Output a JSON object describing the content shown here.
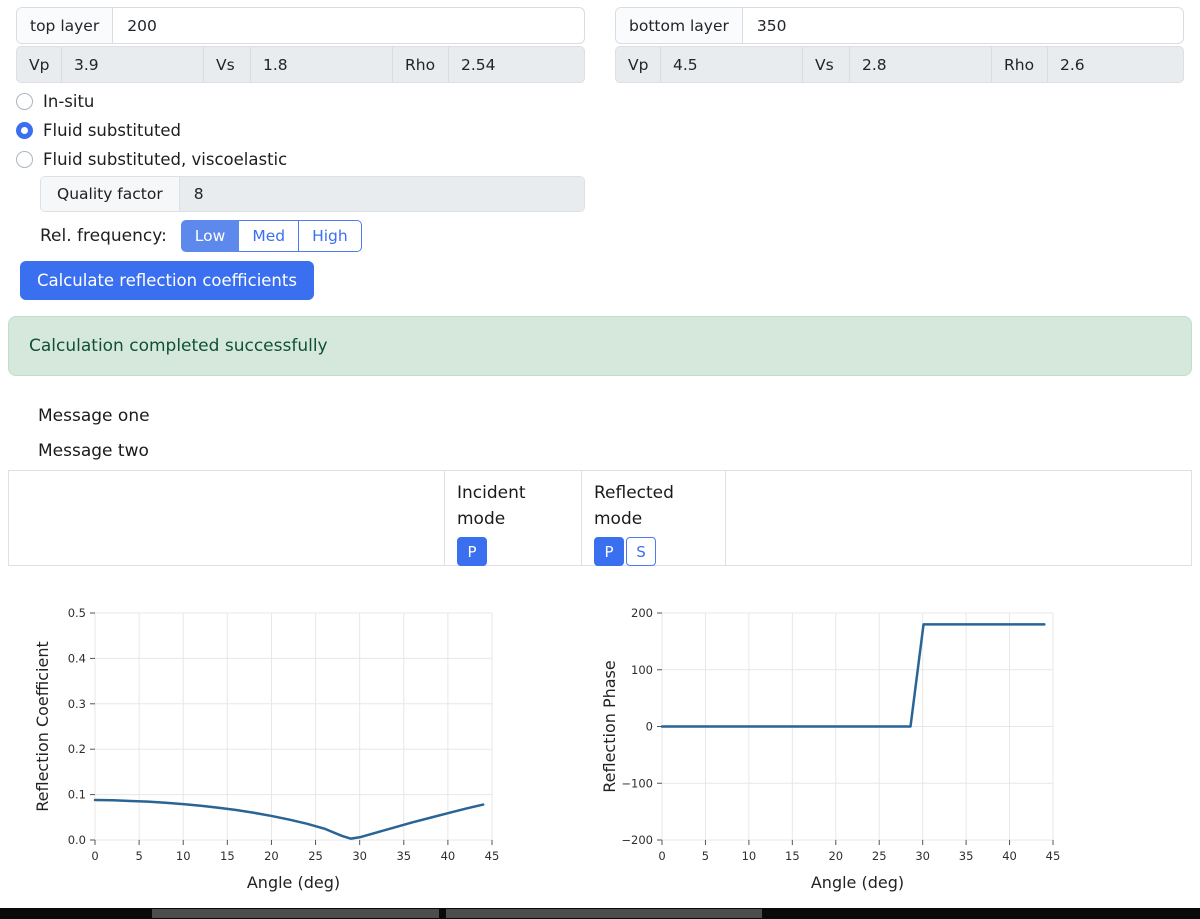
{
  "layers": {
    "top": {
      "label": "top layer",
      "value": "200",
      "vp_label": "Vp",
      "vp": "3.9",
      "vs_label": "Vs",
      "vs": "1.8",
      "rho_label": "Rho",
      "rho": "2.54"
    },
    "bottom": {
      "label": "bottom layer",
      "value": "350",
      "vp_label": "Vp",
      "vp": "4.5",
      "vs_label": "Vs",
      "vs": "2.8",
      "rho_label": "Rho",
      "rho": "2.6"
    }
  },
  "options": {
    "items": [
      {
        "label": "In-situ",
        "selected": false
      },
      {
        "label": "Fluid substituted",
        "selected": true
      },
      {
        "label": "Fluid substituted, viscoelastic",
        "selected": false
      }
    ]
  },
  "quality_factor": {
    "label": "Quality factor",
    "value": "8"
  },
  "rel_frequency": {
    "label": "Rel. frequency:",
    "options": [
      "Low",
      "Med",
      "High"
    ],
    "selected": "Low"
  },
  "calculate_button": "Calculate reflection coefficients",
  "alert": {
    "text": "Calculation completed successfully"
  },
  "messages": [
    "Message one",
    "Message two"
  ],
  "mode_table": {
    "incident": {
      "header": "Incident mode",
      "buttons": [
        {
          "label": "P",
          "active": true
        }
      ]
    },
    "reflected": {
      "header": "Reflected mode",
      "buttons": [
        {
          "label": "P",
          "active": true
        },
        {
          "label": "S",
          "active": false
        }
      ]
    }
  },
  "colors": {
    "primary": "#3a6ff0",
    "primary_light": "#5d89ec",
    "primary_border": "#4d7cf0",
    "success_bg": "#d6e8dc",
    "success_border": "#c3dccc",
    "success_text": "#0f5132",
    "line": "#2a6496"
  },
  "chart_data": [
    {
      "type": "line",
      "title": "",
      "xlabel": "Angle (deg)",
      "ylabel": "Reflection Coefficient",
      "xlim": [
        0,
        45
      ],
      "ylim": [
        0,
        0.5
      ],
      "xticks": [
        0,
        5,
        10,
        15,
        20,
        25,
        30,
        35,
        40,
        45
      ],
      "xtick_labels": [
        "0",
        "5",
        "10",
        "15",
        "20",
        "25",
        "30",
        "35",
        "40",
        "45"
      ],
      "yticks": [
        0,
        0.1,
        0.2,
        0.3,
        0.4,
        0.5
      ],
      "ytick_labels": [
        "0.0",
        "0.1",
        "0.2",
        "0.3",
        "0.4",
        "0.5"
      ],
      "grid": true,
      "legend": false,
      "line_color": "#2a6496",
      "x": [
        0,
        2,
        4,
        6,
        8,
        10,
        12,
        14,
        16,
        18,
        20,
        22,
        24,
        26,
        28,
        29,
        30,
        32,
        34,
        36,
        38,
        40,
        42,
        44
      ],
      "y": [
        0.088,
        0.0875,
        0.086,
        0.0845,
        0.082,
        0.079,
        0.0755,
        0.071,
        0.066,
        0.06,
        0.053,
        0.045,
        0.036,
        0.025,
        0.009,
        0.003,
        0.006,
        0.017,
        0.028,
        0.039,
        0.049,
        0.059,
        0.069,
        0.078
      ]
    },
    {
      "type": "line",
      "title": "",
      "xlabel": "Angle (deg)",
      "ylabel": "Reflection Phase",
      "xlim": [
        0,
        45
      ],
      "ylim": [
        -200,
        200
      ],
      "xticks": [
        0,
        5,
        10,
        15,
        20,
        25,
        30,
        35,
        40,
        45
      ],
      "xtick_labels": [
        "0",
        "5",
        "10",
        "15",
        "20",
        "25",
        "30",
        "35",
        "40",
        "45"
      ],
      "yticks": [
        -200,
        -100,
        0,
        100,
        200
      ],
      "ytick_labels": [
        "−200",
        "−100",
        "0",
        "100",
        "200"
      ],
      "grid": true,
      "legend": false,
      "line_color": "#2a6496",
      "x": [
        0,
        5,
        10,
        15,
        20,
        25,
        28.6,
        30.1,
        35,
        40,
        44
      ],
      "y": [
        0,
        0,
        0,
        0,
        0,
        0,
        0,
        180,
        180,
        180,
        180
      ]
    }
  ]
}
